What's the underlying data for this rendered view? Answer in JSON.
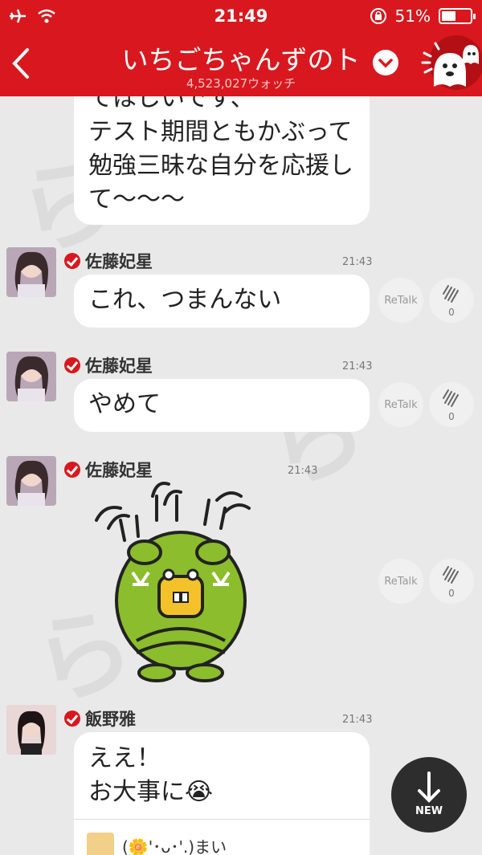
{
  "status": {
    "time": "21:49",
    "battery": "51%",
    "battery_level": 0.51
  },
  "header": {
    "title": "いちごちゃんずのト",
    "watch_count": "4,523,027ウォッチ"
  },
  "messages": [
    {
      "text": "てほしいです、\nテスト期間ともかぶって\n勉強三昧な自分を応援し\nて〜〜〜"
    },
    {
      "name": "佐藤妃星",
      "time": "21:43",
      "text": "これ、つまんない",
      "retalk": "ReTalk",
      "claps": "0"
    },
    {
      "name": "佐藤妃星",
      "time": "21:43",
      "text": "やめて",
      "retalk": "ReTalk",
      "claps": "0"
    },
    {
      "name": "佐藤妃星",
      "time": "21:43",
      "sticker": "frog-sticker",
      "retalk": "ReTalk",
      "claps": "0"
    },
    {
      "name": "飯野雅",
      "time": "21:43",
      "text": "ええ！\nお大事に😭"
    }
  ],
  "reply_preview": {
    "name": "(🌼'･ᴗ･'.)まい"
  },
  "new_button": {
    "label": "NEW"
  },
  "colors": {
    "brand": "#d8181e",
    "badge": "#d8181e"
  }
}
